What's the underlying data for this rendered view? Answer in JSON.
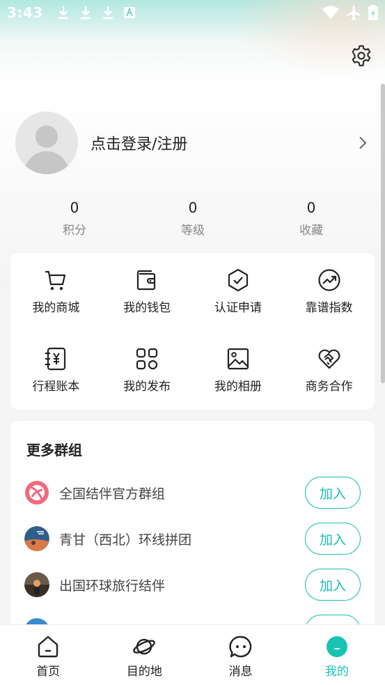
{
  "status_bar": {
    "time": "3:43",
    "notifications": [
      "download-icon",
      "download-icon",
      "download-icon",
      "a-icon"
    ],
    "right_icons": [
      "wifi-icon",
      "airplane-icon",
      "battery-icon"
    ]
  },
  "profile": {
    "login_label": "点击登录/注册"
  },
  "stats": [
    {
      "value": "0",
      "label": "积分"
    },
    {
      "value": "0",
      "label": "等级"
    },
    {
      "value": "0",
      "label": "收藏"
    }
  ],
  "menu": [
    {
      "label": "我的商城",
      "icon": "cart-icon"
    },
    {
      "label": "我的钱包",
      "icon": "wallet-icon"
    },
    {
      "label": "认证申请",
      "icon": "shield-check-icon"
    },
    {
      "label": "靠谱指数",
      "icon": "trend-icon"
    },
    {
      "label": "行程账本",
      "icon": "ledger-icon"
    },
    {
      "label": "我的发布",
      "icon": "grid-icon"
    },
    {
      "label": "我的相册",
      "icon": "image-icon"
    },
    {
      "label": "商务合作",
      "icon": "handshake-icon"
    }
  ],
  "groups": {
    "title": "更多群组",
    "join_label": "加入",
    "items": [
      {
        "name": "全国结伴官方群组"
      },
      {
        "name": "青甘（西北）环线拼团"
      },
      {
        "name": "出国环球旅行结伴"
      }
    ]
  },
  "tabs": [
    {
      "label": "首页",
      "icon": "home-icon"
    },
    {
      "label": "目的地",
      "icon": "planet-icon"
    },
    {
      "label": "消息",
      "icon": "message-icon"
    },
    {
      "label": "我的",
      "icon": "profile-icon"
    }
  ],
  "colors": {
    "accent": "#19c3b3",
    "text": "#222222",
    "secondary_text": "#888888"
  }
}
